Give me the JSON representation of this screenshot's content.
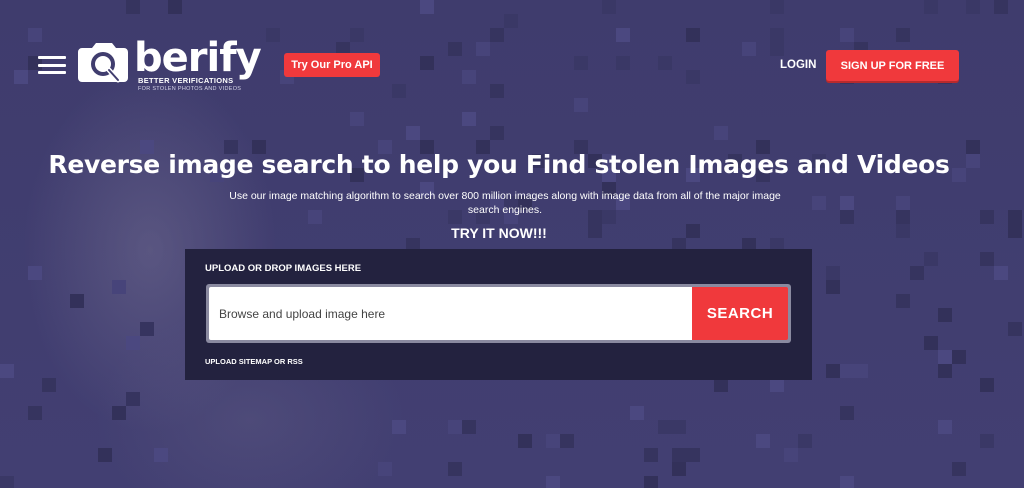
{
  "header": {
    "logo": {
      "wordmark": "berify",
      "tagline": "BETTER VERIFICATIONS",
      "subtagline": "FOR STOLEN PHOTOS AND VIDEOS"
    },
    "pro_api_label": "Try Our Pro API",
    "login_label": "LOGIN",
    "signup_label": "SIGN UP FOR FREE"
  },
  "hero": {
    "headline": "Reverse image search to help you Find stolen Images and Videos",
    "subtext": "Use our image matching algorithm to search over 800 million images along with image data from all of the major image search engines.",
    "cta": "TRY IT NOW!!!"
  },
  "upload": {
    "title": "UPLOAD OR DROP IMAGES HERE",
    "input_placeholder": "Browse and upload image here",
    "search_label": "SEARCH",
    "sitemap_label": "UPLOAD SITEMAP OR RSS"
  },
  "colors": {
    "background": "#403d6e",
    "accent": "#f0393c",
    "panel": "#23223f"
  }
}
